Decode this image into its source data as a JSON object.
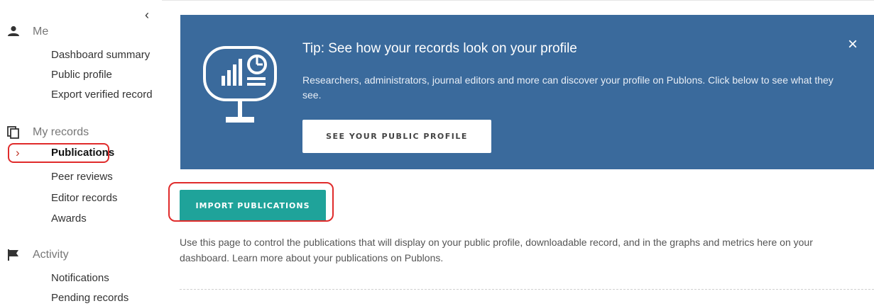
{
  "sidebar": {
    "collapse_icon": "chevron-left-icon",
    "sections": [
      {
        "title": "Me",
        "icon": "person-icon",
        "items": [
          {
            "label": "Dashboard summary"
          },
          {
            "label": "Public profile"
          },
          {
            "label": "Export verified record"
          }
        ]
      },
      {
        "title": "My records",
        "icon": "copy-icon",
        "items": [
          {
            "label": "Publications",
            "active": true
          },
          {
            "label": "Peer reviews"
          },
          {
            "label": "Editor records"
          },
          {
            "label": "Awards"
          }
        ]
      },
      {
        "title": "Activity",
        "icon": "flag-icon",
        "items": [
          {
            "label": "Notifications"
          },
          {
            "label": "Pending records"
          }
        ]
      }
    ]
  },
  "tip": {
    "title": "Tip: See how your records look on your profile",
    "body": "Researchers, administrators, journal editors and more can discover your profile on Publons. Click below to see what they see.",
    "button": "SEE YOUR PUBLIC PROFILE",
    "close": "×",
    "icon": "monitor-chart-icon"
  },
  "main": {
    "import_button": "IMPORT PUBLICATIONS",
    "description": "Use this page to control the publications that will display on your public profile, downloadable record, and in the graphs and metrics here on your dashboard. Learn more about your publications on Publons."
  },
  "colors": {
    "banner": "#3a6a9c",
    "import_button": "#1fa39a",
    "highlight": "#e02b2b"
  }
}
